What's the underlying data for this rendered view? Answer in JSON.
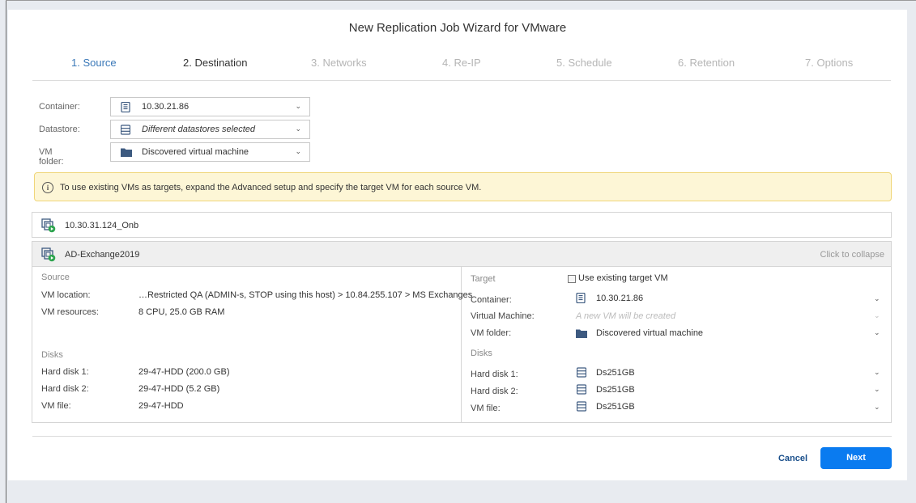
{
  "dialog": {
    "title": "New Replication Job Wizard for VMware"
  },
  "tabs": [
    {
      "label": "1. Source",
      "state": "done"
    },
    {
      "label": "2. Destination",
      "state": "active"
    },
    {
      "label": "3. Networks",
      "state": "disabled"
    },
    {
      "label": "4. Re-IP",
      "state": "disabled"
    },
    {
      "label": "5. Schedule",
      "state": "disabled"
    },
    {
      "label": "6. Retention",
      "state": "disabled"
    },
    {
      "label": "7. Options",
      "state": "disabled"
    }
  ],
  "form": {
    "container": {
      "label": "Container:",
      "value": "10.30.21.86",
      "icon": "server-icon"
    },
    "datastore": {
      "label": "Datastore:",
      "value": "Different datastores selected",
      "icon": "datastore-icon"
    },
    "vm_folder": {
      "label": "VM folder:",
      "value": "Discovered virtual machine",
      "icon": "folder-icon"
    }
  },
  "banner": {
    "text": "To use existing VMs as targets, expand the Advanced setup and specify the target VM for each source VM."
  },
  "vms": [
    {
      "name": "10.30.31.124_Onb"
    },
    {
      "name": "AD-Exchange2019",
      "collapse_label": "Click to collapse"
    }
  ],
  "source": {
    "heading": "Source",
    "vm_location_label": "VM location:",
    "vm_location_value": "…Restricted QA (ADMIN-s, STOP using this host) > 10.84.255.107 > MS Exchanges",
    "vm_resources_label": "VM resources:",
    "vm_resources_value": "8 CPU, 25.0 GB RAM",
    "disks_heading": "Disks",
    "disks": [
      {
        "label": "Hard disk 1:",
        "value": "29-47-HDD (200.0 GB)"
      },
      {
        "label": "Hard disk 2:",
        "value": "29-47-HDD (5.2 GB)"
      },
      {
        "label": "VM file:",
        "value": "29-47-HDD"
      }
    ]
  },
  "target": {
    "heading": "Target",
    "use_existing_label": "Use existing target VM",
    "use_existing_checked": false,
    "container_label": "Container:",
    "container_value": "10.30.21.86",
    "vm_label": "Virtual Machine:",
    "vm_placeholder": "A new VM will be created",
    "vm_folder_label": "VM folder:",
    "vm_folder_value": "Discovered virtual machine",
    "disks_heading": "Disks",
    "disks": [
      {
        "label": "Hard disk 1:",
        "value": "Ds251GB"
      },
      {
        "label": "Hard disk 2:",
        "value": "Ds251GB"
      },
      {
        "label": "VM file:",
        "value": "Ds251GB"
      }
    ]
  },
  "footer": {
    "cancel_label": "Cancel",
    "next_label": "Next"
  },
  "colors": {
    "accent": "#0a7bf0",
    "tab_done": "#3a78b8",
    "banner_bg": "#fdf6d6",
    "folder": "#3d5a80"
  }
}
